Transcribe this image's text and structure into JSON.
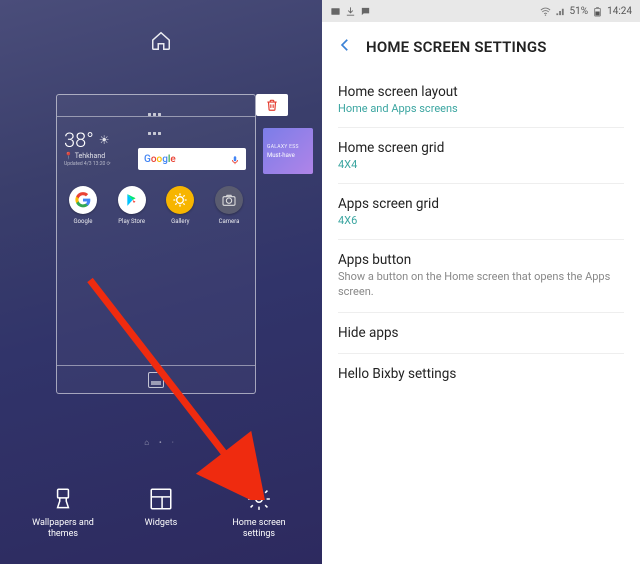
{
  "left": {
    "weather": {
      "temp": "38°",
      "location": "Tehkhand",
      "updated": "Updated 4/3 13:20 ⟳"
    },
    "next_panel": {
      "tag": "GALAXY ESS",
      "title": "Must-have"
    },
    "apps": [
      {
        "name": "google",
        "label": "Google"
      },
      {
        "name": "playstore",
        "label": "Play Store"
      },
      {
        "name": "gallery",
        "label": "Gallery"
      },
      {
        "name": "camera",
        "label": "Camera"
      }
    ],
    "actions": {
      "wallpapers": "Wallpapers and themes",
      "widgets": "Widgets",
      "settings": "Home screen settings"
    }
  },
  "right": {
    "statusbar": {
      "battery": "51%",
      "time": "14:24"
    },
    "header": "HOME SCREEN SETTINGS",
    "items": [
      {
        "title": "Home screen layout",
        "sub": "Home and Apps screens"
      },
      {
        "title": "Home screen grid",
        "sub": "4X4"
      },
      {
        "title": "Apps screen grid",
        "sub": "4X6"
      },
      {
        "title": "Apps button",
        "desc": "Show a button on the Home screen that opens the Apps screen."
      },
      {
        "title": "Hide apps"
      },
      {
        "title": "Hello Bixby settings"
      }
    ]
  }
}
